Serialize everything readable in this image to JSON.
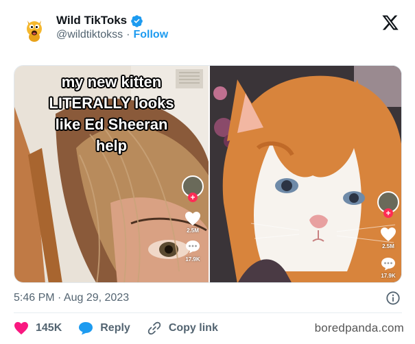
{
  "tweet": {
    "display_name": "Wild TikToks",
    "handle": "@wildtiktokss",
    "separator": "·",
    "follow_label": "Follow",
    "timestamp": "5:46 PM · Aug 29, 2023"
  },
  "media": {
    "caption_lines": [
      "my new kitten",
      "LITERALLY looks",
      "like Ed Sheeran",
      "help"
    ],
    "left_panel": {
      "likes": "2.5M",
      "comments": "17.9K"
    },
    "right_panel": {
      "likes": "2.5M",
      "comments": "17.9K"
    }
  },
  "actions": {
    "like_count": "145K",
    "reply_label": "Reply",
    "copy_link_label": "Copy link"
  },
  "watermark": "boredpanda.com",
  "colors": {
    "accent_blue": "#1d9bf0",
    "like_pink": "#f91880",
    "tiktok_red": "#fe2c55",
    "muted_text": "#536471"
  },
  "icons": [
    "avatar-icon",
    "verified-badge-icon",
    "x-logo-icon",
    "info-icon",
    "heart-icon",
    "reply-bubble-icon",
    "link-icon"
  ]
}
